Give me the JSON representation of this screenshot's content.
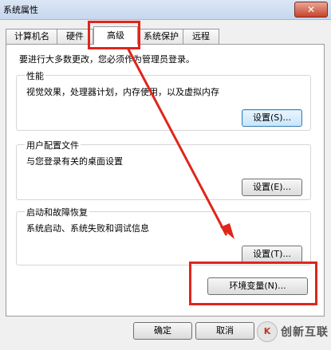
{
  "window": {
    "title": "系统属性",
    "close_label": "✕"
  },
  "tabs": [
    {
      "label": "计算机名"
    },
    {
      "label": "硬件"
    },
    {
      "label": "高级"
    },
    {
      "label": "系统保护"
    },
    {
      "label": "远程"
    }
  ],
  "intro": "要进行大多数更改，您必须作为管理员登录。",
  "performance": {
    "title": "性能",
    "desc": "视觉效果，处理器计划，内存使用，以及虚拟内存",
    "button": "设置(S)..."
  },
  "profiles": {
    "title": "用户配置文件",
    "desc": "与您登录有关的桌面设置",
    "button": "设置(E)..."
  },
  "startup": {
    "title": "启动和故障恢复",
    "desc": "系统启动、系统失败和调试信息",
    "button": "设置(T)..."
  },
  "env_button": "环境变量(N)...",
  "footer": {
    "ok": "确定",
    "cancel": "取消"
  },
  "watermark": {
    "text": "创新互联",
    "icon_text": "K"
  },
  "colors": {
    "highlight": "#e0251b"
  }
}
